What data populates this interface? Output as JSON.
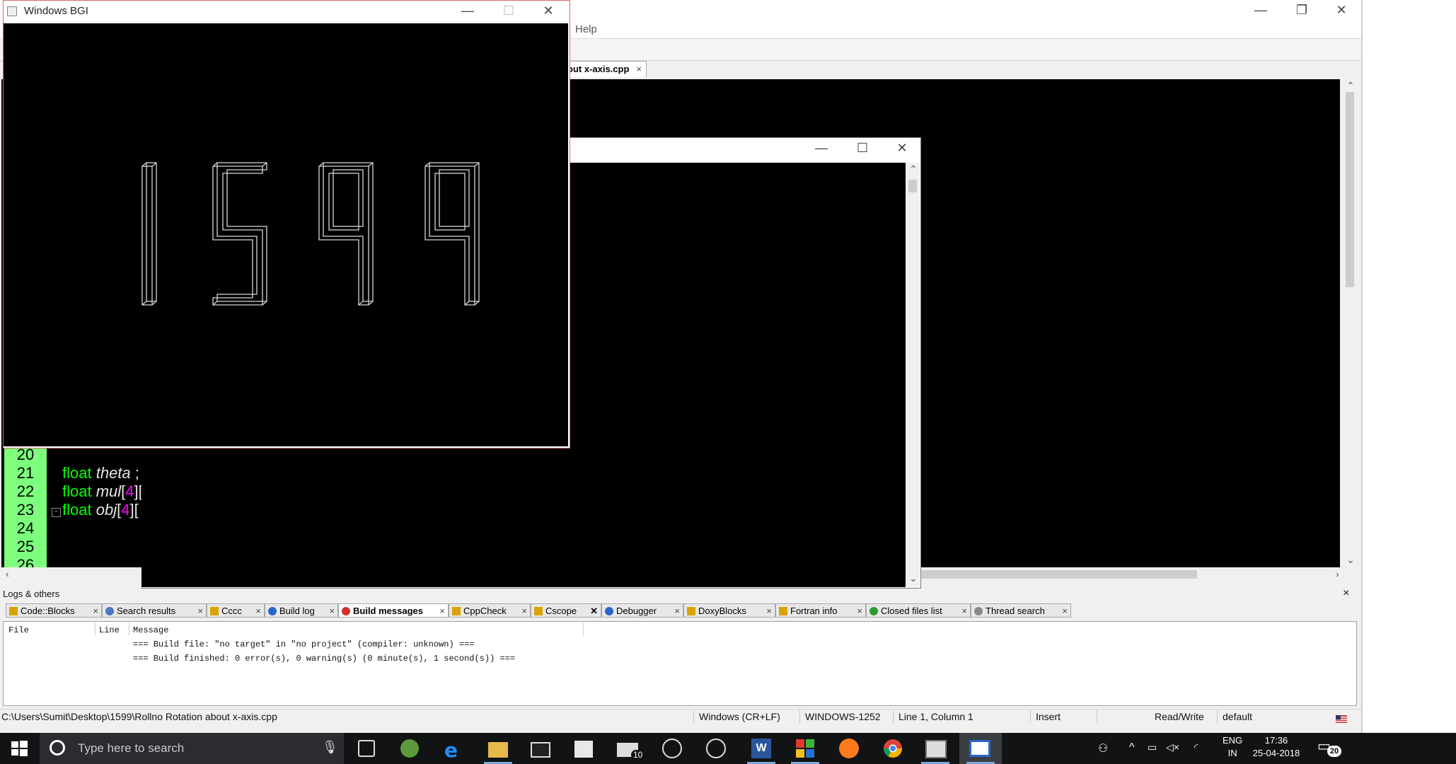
{
  "bgi_window": {
    "title": "Windows BGI",
    "minimize": "—",
    "maximize": "☐",
    "close": "✕"
  },
  "codeblocks": {
    "menu_help": "Help",
    "window_controls": {
      "minimize": "—",
      "restore": "❐",
      "close": "✕"
    },
    "editor_tab": {
      "label": "out x-axis.cpp",
      "close": "×"
    },
    "line_numbers": [
      "20",
      "21",
      "22",
      "23",
      "24",
      "25",
      "26"
    ],
    "code_lines": [
      {
        "kw": "float",
        "id": "theta",
        "rest": " ;"
      },
      {
        "kw": "float",
        "id": "mul",
        "b1": "[",
        "n1": "4",
        "b2": "][",
        "n2": ""
      },
      {
        "kw": "float",
        "id": "obj",
        "b1": "[",
        "n1": "4",
        "b2": "][",
        "n2": ""
      }
    ]
  },
  "console_window": {
    "minimize": "—",
    "maximize": "☐",
    "close": "✕"
  },
  "logs": {
    "panel_title": "Logs & others",
    "close": "×",
    "tabs": [
      {
        "label": "Code::Blocks",
        "icon_color": "#d9a400"
      },
      {
        "label": "Search results",
        "icon_color": "#4a78c2"
      },
      {
        "label": "Cccc",
        "icon_color": "#d9a400"
      },
      {
        "label": "Build log",
        "icon_color": "#2a66c9"
      },
      {
        "label": "Build messages",
        "icon_color": "#d23030"
      },
      {
        "label": "CppCheck",
        "icon_color": "#d9a400"
      },
      {
        "label": "Cscope",
        "icon_color": "#d9a400"
      },
      {
        "label": "Debugger",
        "icon_color": "#2a66c9"
      },
      {
        "label": "DoxyBlocks",
        "icon_color": "#d9a400"
      },
      {
        "label": "Fortran info",
        "icon_color": "#d9a400"
      },
      {
        "label": "Closed files list",
        "icon_color": "#2e9a2e"
      },
      {
        "label": "Thread search",
        "icon_color": "#8a8a8a"
      }
    ],
    "active_tab": "Build messages",
    "columns": {
      "file": "File",
      "line": "Line",
      "message": "Message"
    },
    "messages": [
      "=== Build file: \"no target\" in \"no project\" (compiler: unknown) ===",
      "=== Build finished: 0 error(s), 0 warning(s) (0 minute(s), 1 second(s)) ==="
    ]
  },
  "statusbar": {
    "path": "C:\\Users\\Sumit\\Desktop\\1599\\Rollno Rotation about x-axis.cpp",
    "eol": "Windows (CR+LF)",
    "encoding": "WINDOWS-1252",
    "position": "Line 1, Column 1",
    "mode": "Insert",
    "access": "Read/Write",
    "profile": "default"
  },
  "taskbar": {
    "search_placeholder": "Type here to search",
    "mail_badge": "10",
    "lang_line1": "ENG",
    "lang_line2": "IN",
    "time": "17:36",
    "date": "25-04-2018",
    "notification_count": "20"
  },
  "colors": {
    "gutter": "#7dff7d",
    "keyword": "#00ff00",
    "number": "#ff00ff",
    "bgi_border": "#d86a6a"
  }
}
